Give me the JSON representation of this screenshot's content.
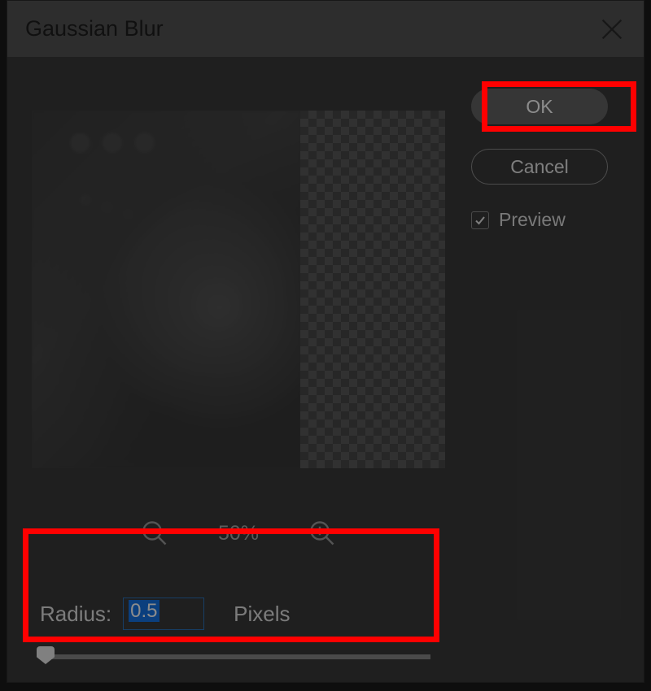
{
  "dialog": {
    "title": "Gaussian Blur",
    "close_icon": "close"
  },
  "buttons": {
    "ok": "OK",
    "cancel": "Cancel"
  },
  "preview_toggle": {
    "label": "Preview",
    "checked": true
  },
  "zoom": {
    "level": "50%"
  },
  "radius": {
    "label": "Radius:",
    "value": "0.5",
    "units": "Pixels",
    "slider_min": 0.1,
    "slider_max": 1000,
    "slider_value": 0.5
  },
  "highlights": {
    "ok_box_color": "#ff0000",
    "radius_box_color": "#ff0000"
  }
}
